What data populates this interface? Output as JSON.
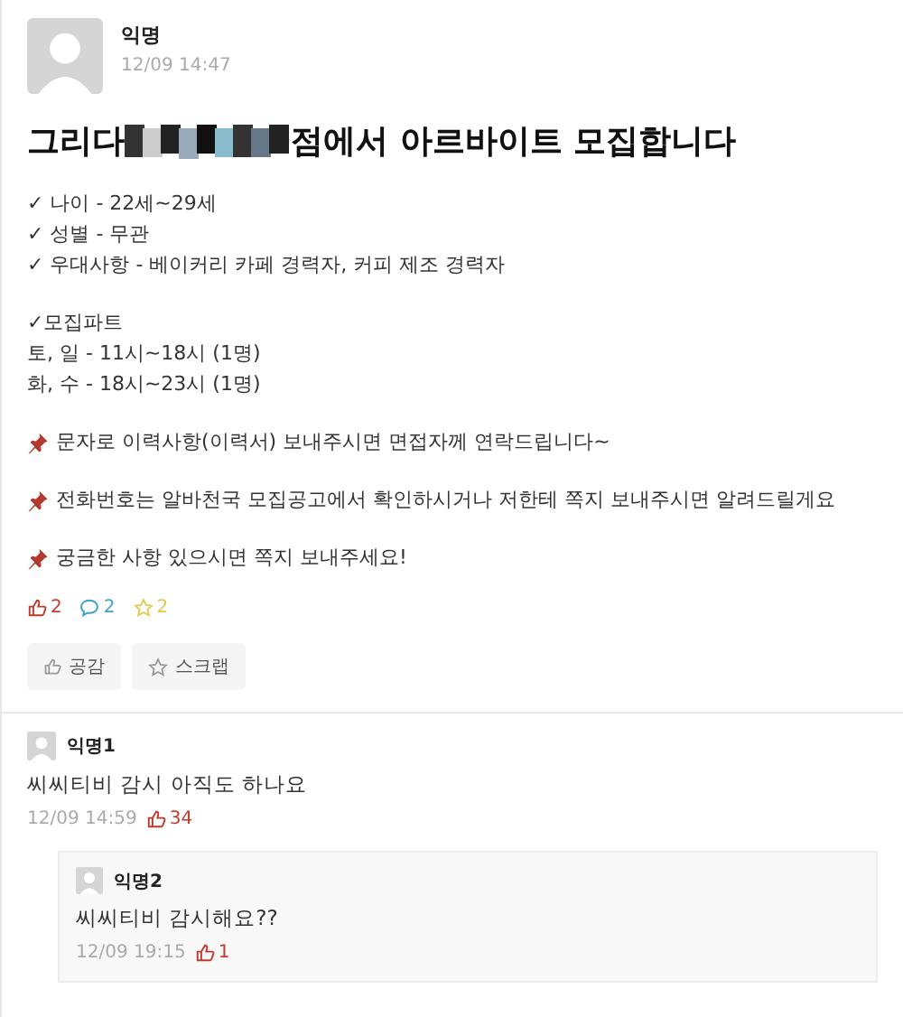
{
  "post": {
    "author": "익명",
    "time": "12/09 14:47",
    "title_start": "그리다",
    "title_end": "점에서 아르바이트 모집합니다",
    "paragraphs": [
      {
        "kind": "plain",
        "lines": [
          "✓ 나이 - 22세~29세",
          "✓ 성별 - 무관",
          "✓ 우대사항 - 베이커리 카페 경력자, 커피 제조 경력자"
        ]
      },
      {
        "kind": "plain",
        "lines": [
          "✓모집파트",
          "토, 일 - 11시~18시 (1명)",
          "화, 수 - 18시~23시 (1명)"
        ]
      },
      {
        "kind": "pin",
        "lines": [
          "문자로 이력사항(이력서) 보내주시면 면접자께 연락드립니다~"
        ]
      },
      {
        "kind": "pin",
        "lines": [
          "전화번호는 알바천국 모집공고에서 확인하시거나 저한테 쪽지 보내주시면 알려드릴게요"
        ]
      },
      {
        "kind": "pin",
        "lines": [
          "궁금한 사항 있으시면 쪽지 보내주세요!"
        ]
      }
    ],
    "stats": [
      {
        "kind": "like",
        "count": "2"
      },
      {
        "kind": "comment",
        "count": "2"
      },
      {
        "kind": "scrap",
        "count": "2"
      }
    ],
    "buttons": [
      {
        "kind": "like",
        "label": "공감"
      },
      {
        "kind": "scrap",
        "label": "스크랩"
      }
    ]
  },
  "comments": [
    {
      "author": "익명1",
      "text": "씨씨티비 감시 아직도 하나요",
      "time": "12/09 14:59",
      "likes": "34",
      "replies": [
        {
          "author": "익명2",
          "text": "씨씨티비 감시해요??",
          "time": "12/09 19:15",
          "likes": "1"
        }
      ]
    }
  ]
}
